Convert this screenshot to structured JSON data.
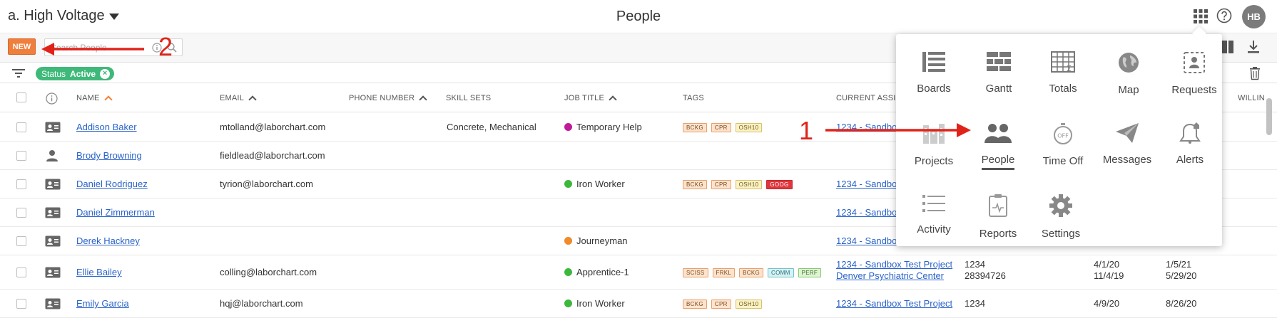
{
  "header": {
    "org_name": "a. High Voltage",
    "page_title": "People",
    "avatar_initials": "HB"
  },
  "toolbar": {
    "new_label": "NEW",
    "search_placeholder": "Search People"
  },
  "filter": {
    "chip_key": "Status",
    "chip_value": "Active"
  },
  "table": {
    "headers": {
      "name": "NAME",
      "email": "EMAIL",
      "phone": "PHONE NUMBER",
      "skills": "SKILL SETS",
      "job_title": "JOB TITLE",
      "tags": "TAGS",
      "current_assignment": "CURRENT ASSIG",
      "willing": "WILLIN"
    },
    "rows": [
      {
        "name": "Addison Baker",
        "email": "mtolland@laborchart.com",
        "skills": "Concrete, Mechanical",
        "job_title": "Temporary Help",
        "job_color": "#c0199a",
        "tags": [
          "BCKG",
          "CPR",
          "OSH10"
        ],
        "project": "1234 - Sandbox",
        "project2": ""
      },
      {
        "name": "Brody Browning",
        "email": "fieldlead@laborchart.com",
        "skills": "",
        "job_title": "",
        "job_color": "",
        "tags": [],
        "project": "",
        "project2": ""
      },
      {
        "name": "Daniel Rodriguez",
        "email": "tyrion@laborchart.com",
        "skills": "",
        "job_title": "Iron Worker",
        "job_color": "#3cb83c",
        "tags": [
          "BCKG",
          "CPR",
          "OSH10",
          "GOOG"
        ],
        "project": "1234 - Sandbox",
        "project2": ""
      },
      {
        "name": "Daniel Zimmerman",
        "email": "",
        "skills": "",
        "job_title": "",
        "job_color": "",
        "tags": [],
        "project": "1234 - Sandbox",
        "project2": ""
      },
      {
        "name": "Derek Hackney",
        "email": "",
        "skills": "",
        "job_title": "Journeyman",
        "job_color": "#f08a2a",
        "tags": [],
        "project": "1234 - Sandbox",
        "project2": ""
      },
      {
        "name": "Ellie Bailey",
        "email": "colling@laborchart.com",
        "skills": "",
        "job_title": "Apprentice-1",
        "job_color": "#3cb83c",
        "tags": [
          "SCISS",
          "FRKL",
          "BCKG",
          "COMM",
          "PERF"
        ],
        "project": "1234 - Sandbox Test Project",
        "project2": "Denver Psychiatric Center",
        "num": "1234",
        "num2": "28394726",
        "date1": "4/1/20",
        "date1b": "11/4/19",
        "date2": "1/5/21",
        "date2b": "5/29/20"
      },
      {
        "name": "Emily Garcia",
        "email": "hqj@laborchart.com",
        "skills": "",
        "job_title": "Iron Worker",
        "job_color": "#3cb83c",
        "tags": [
          "BCKG",
          "CPR",
          "OSH10"
        ],
        "project": "1234 - Sandbox Test Project",
        "project2": "",
        "num": "1234",
        "date1": "4/9/20",
        "date2": "8/26/20"
      }
    ]
  },
  "apps_menu": {
    "items": [
      {
        "label": "Boards",
        "icon": "boards-icon"
      },
      {
        "label": "Gantt",
        "icon": "gantt-icon"
      },
      {
        "label": "Totals",
        "icon": "totals-icon"
      },
      {
        "label": "Map",
        "icon": "map-icon"
      },
      {
        "label": "Requests",
        "icon": "requests-icon"
      },
      {
        "label": "Projects",
        "icon": "projects-icon"
      },
      {
        "label": "People",
        "icon": "people-icon"
      },
      {
        "label": "Time Off",
        "icon": "time-off-icon",
        "badge": "OFF"
      },
      {
        "label": "Messages",
        "icon": "messages-icon"
      },
      {
        "label": "Alerts",
        "icon": "alerts-icon"
      },
      {
        "label": "Activity",
        "icon": "activity-icon"
      },
      {
        "label": "Reports",
        "icon": "reports-icon"
      },
      {
        "label": "Settings",
        "icon": "settings-icon"
      }
    ]
  },
  "annotations": {
    "step1": "1",
    "step2": "2"
  },
  "colors": {
    "accent": "#f07f3c",
    "link": "#2a63c9",
    "status_chip": "#3fb97a",
    "annotation": "#e0231a"
  }
}
